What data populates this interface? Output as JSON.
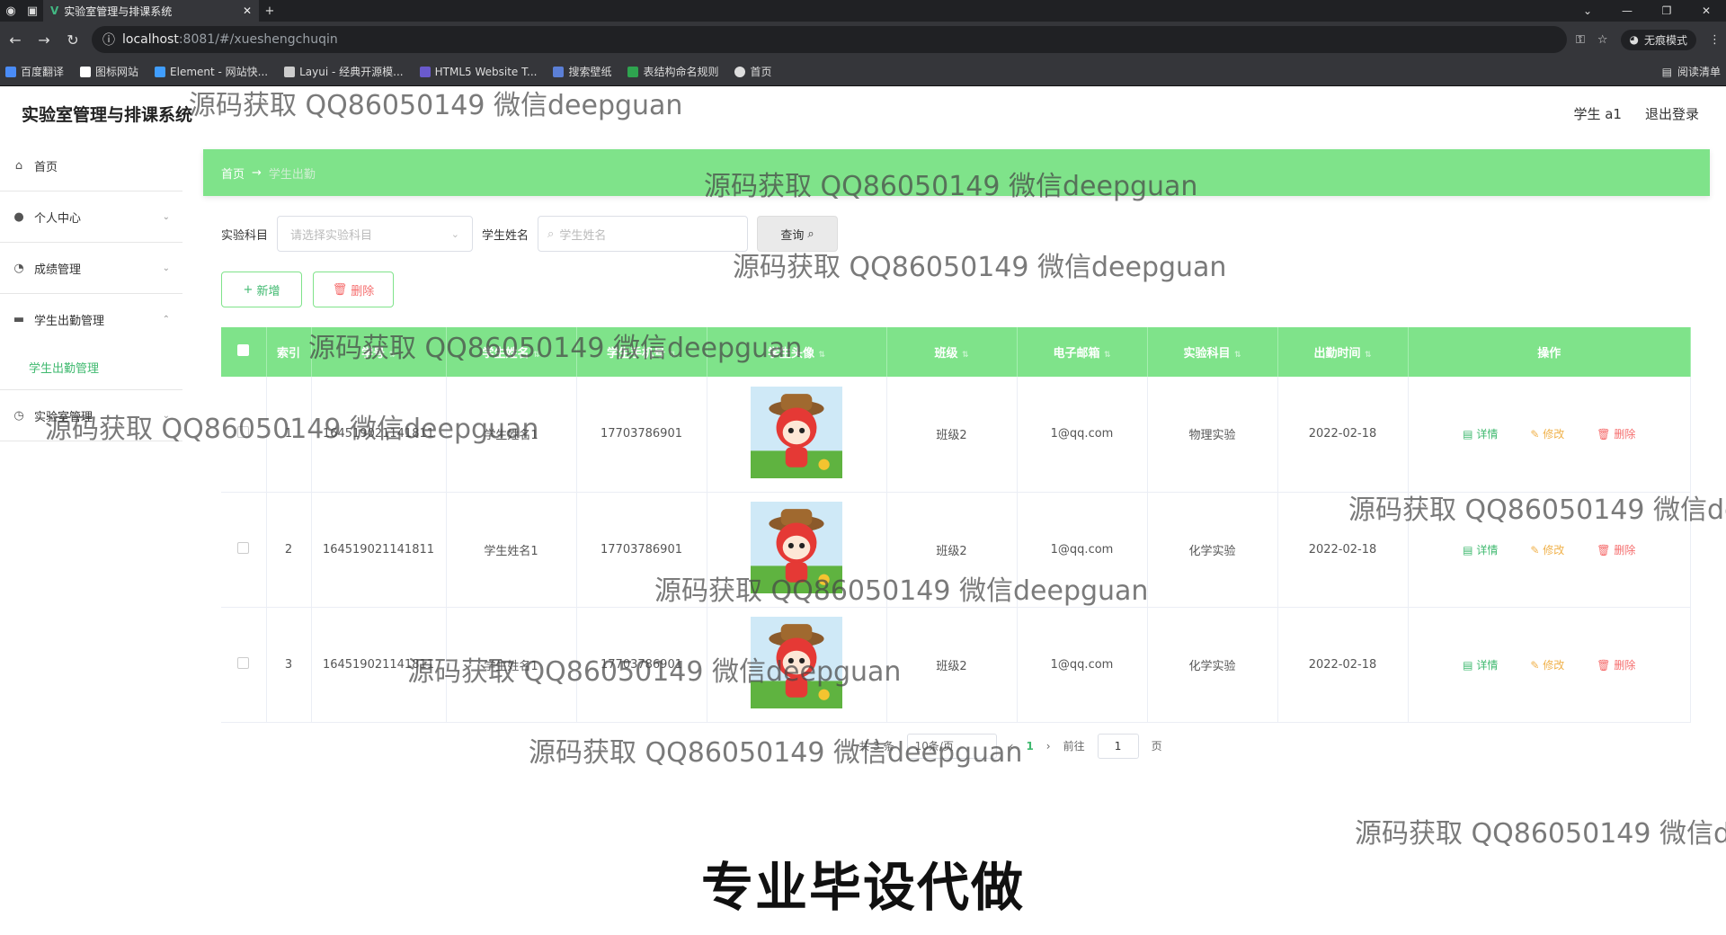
{
  "browser": {
    "tab_title": "实验室管理与排课系统",
    "url_host": "localhost",
    "url_path": ":8081/#/xueshengchuqin",
    "incognito_label": "无痕模式",
    "bookmarks": [
      "百度翻译",
      "图标网站",
      "Element - 网站快...",
      "Layui - 经典开源模...",
      "HTML5 Website T...",
      "搜索壁纸",
      "表结构命名规则",
      "首页"
    ],
    "reading_list": "阅读清单"
  },
  "header": {
    "title": "实验室管理与排课系统",
    "user": "学生 a1",
    "logout": "退出登录"
  },
  "sidebar": {
    "items": [
      {
        "label": "首页",
        "icon": "home-icon"
      },
      {
        "label": "个人中心",
        "icon": "user-icon"
      },
      {
        "label": "成绩管理",
        "icon": "gauge-icon"
      },
      {
        "label": "学生出勤管理",
        "icon": "briefcase-icon"
      },
      {
        "label": "实验室管理",
        "icon": "clock-icon"
      }
    ],
    "sub_item": "学生出勤管理"
  },
  "breadcrumb": {
    "home": "首页",
    "arrow": "→",
    "current": "学生出勤"
  },
  "search": {
    "subject_label": "实验科目",
    "subject_placeholder": "请选择实验科目",
    "name_label": "学生姓名",
    "name_placeholder": "学生姓名",
    "query_button": "查询"
  },
  "actions": {
    "add": "新增",
    "delete": "删除"
  },
  "table": {
    "headers": [
      "索引",
      "学号",
      "学生姓名",
      "学生手机号",
      "学生头像",
      "班级",
      "电子邮箱",
      "实验科目",
      "出勤时间",
      "操作"
    ],
    "rows": [
      {
        "index": "1",
        "student_no": "164519021141811",
        "name": "学生姓名1",
        "phone": "17703786901",
        "class": "班级2",
        "email": "1@qq.com",
        "subject": "物理实验",
        "date": "2022-02-18"
      },
      {
        "index": "2",
        "student_no": "164519021141811",
        "name": "学生姓名1",
        "phone": "17703786901",
        "class": "班级2",
        "email": "1@qq.com",
        "subject": "化学实验",
        "date": "2022-02-18"
      },
      {
        "index": "3",
        "student_no": "164519021141811",
        "name": "学生姓名1",
        "phone": "17703786901",
        "class": "班级2",
        "email": "1@qq.com",
        "subject": "化学实验",
        "date": "2022-02-18"
      }
    ],
    "op_detail": "详情",
    "op_edit": "修改",
    "op_delete": "删除"
  },
  "pagination": {
    "total": "共 3 条",
    "page_size": "10条/页",
    "current_page": "1",
    "goto_label": "前往",
    "goto_value": "1",
    "page_suffix": "页"
  },
  "watermark_text": "源码获取 QQ86050149 微信deepguan",
  "banner": "专业毕设代做"
}
